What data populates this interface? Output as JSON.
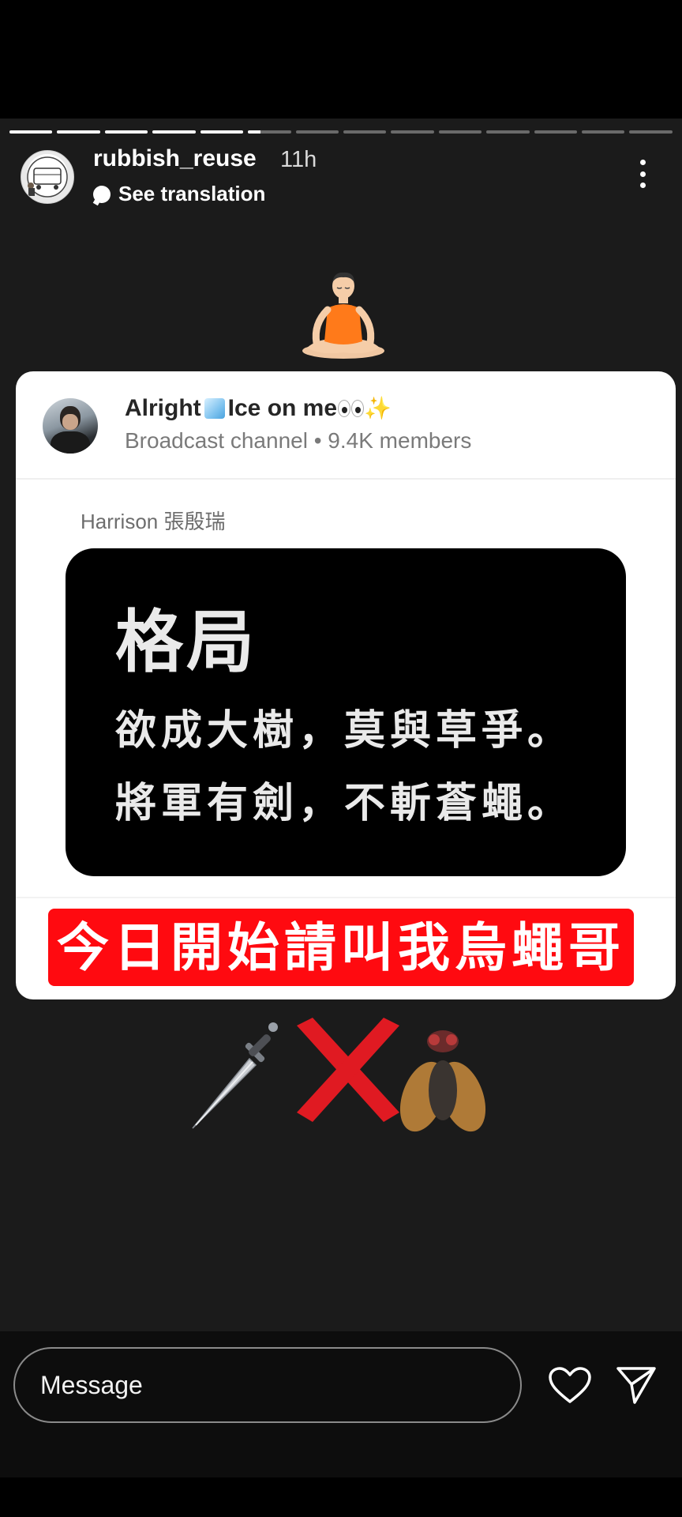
{
  "story": {
    "progress": {
      "segments": 14,
      "completed": 5,
      "current_fraction": 0.3
    },
    "username": "rubbish_reuse",
    "time_ago": "11h",
    "see_translation": "See translation"
  },
  "shared_post": {
    "channel_title_part1": "Alright",
    "channel_title_part2": "Ice on me",
    "channel_subtitle": "Broadcast channel • 9.4K members",
    "sender": "Harrison 張殷瑞",
    "quote_title": "格局",
    "quote_line1": "欲成大樹，莫與草爭。",
    "quote_line2": "將軍有劍，不斬蒼蠅。",
    "banner": "今日開始請叫我烏蠅哥",
    "colors": {
      "banner": "#ff0a10",
      "quote_bg": "#000000"
    }
  },
  "reply": {
    "placeholder": "Message"
  },
  "icons": [
    "meditating-person-emoji",
    "dagger-emoji",
    "cross-mark-emoji",
    "fly-emoji",
    "heart-icon",
    "send-icon",
    "more-options-icon"
  ]
}
